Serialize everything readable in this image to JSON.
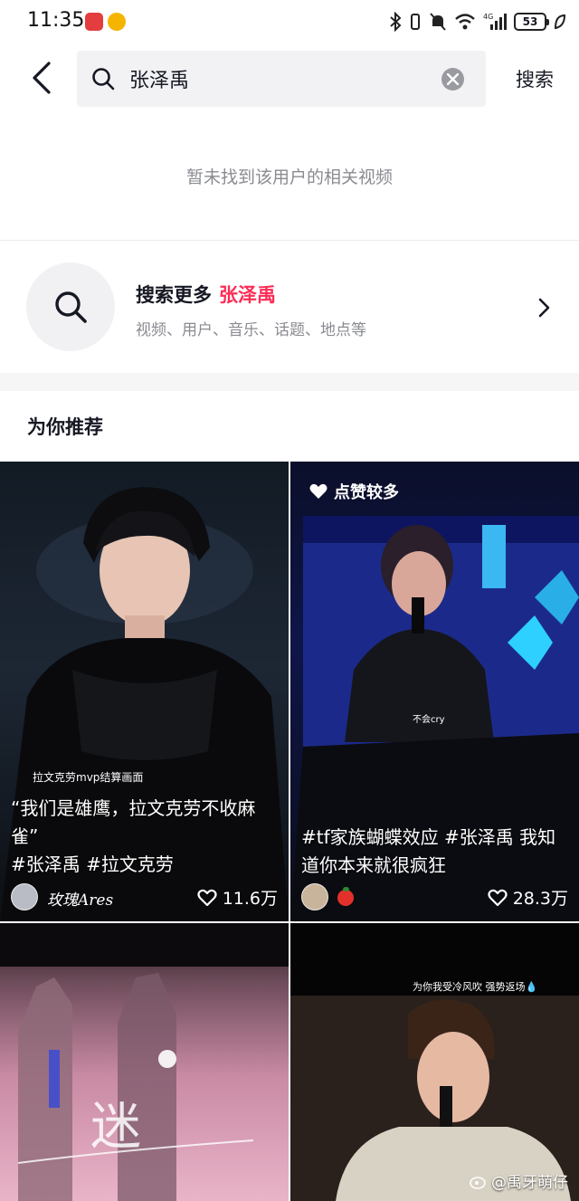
{
  "status_bar": {
    "time": "11:35",
    "battery": "53",
    "network": "4G"
  },
  "search": {
    "query": "张泽禹",
    "submit_label": "搜索"
  },
  "empty_message": "暂未找到该用户的相关视频",
  "search_more": {
    "prefix": "搜索更多",
    "keyword": "张泽禹",
    "subtitle": "视频、用户、音乐、话题、地点等"
  },
  "recommend": {
    "title": "为你推荐",
    "cards": [
      {
        "inner_caption": "拉文克劳mvp结算画面",
        "caption_line1": "“我们是雄鹰，拉文克劳不收麻",
        "caption_line2": "雀”",
        "caption_line3": "#张泽禹 #拉文克劳",
        "author": "玫瑰Ares",
        "likes": "11.6万"
      },
      {
        "badge": "点赞较多",
        "inner_caption": "不会cry",
        "caption_line1": "#tf家族蝴蝶效应 #张泽禹 我知",
        "caption_line2": "道你本来就很疯狂",
        "author": "",
        "likes": "28.3万"
      },
      {
        "art_text": "迷"
      },
      {
        "inner_caption": "为你我受冷风吹 强势返场💧"
      }
    ]
  },
  "watermark": "@禹牙萌仔",
  "colors": {
    "accent": "#fe2c55",
    "text_primary": "#161823",
    "text_secondary": "#8a8b91",
    "search_bg": "#f2f2f4"
  }
}
